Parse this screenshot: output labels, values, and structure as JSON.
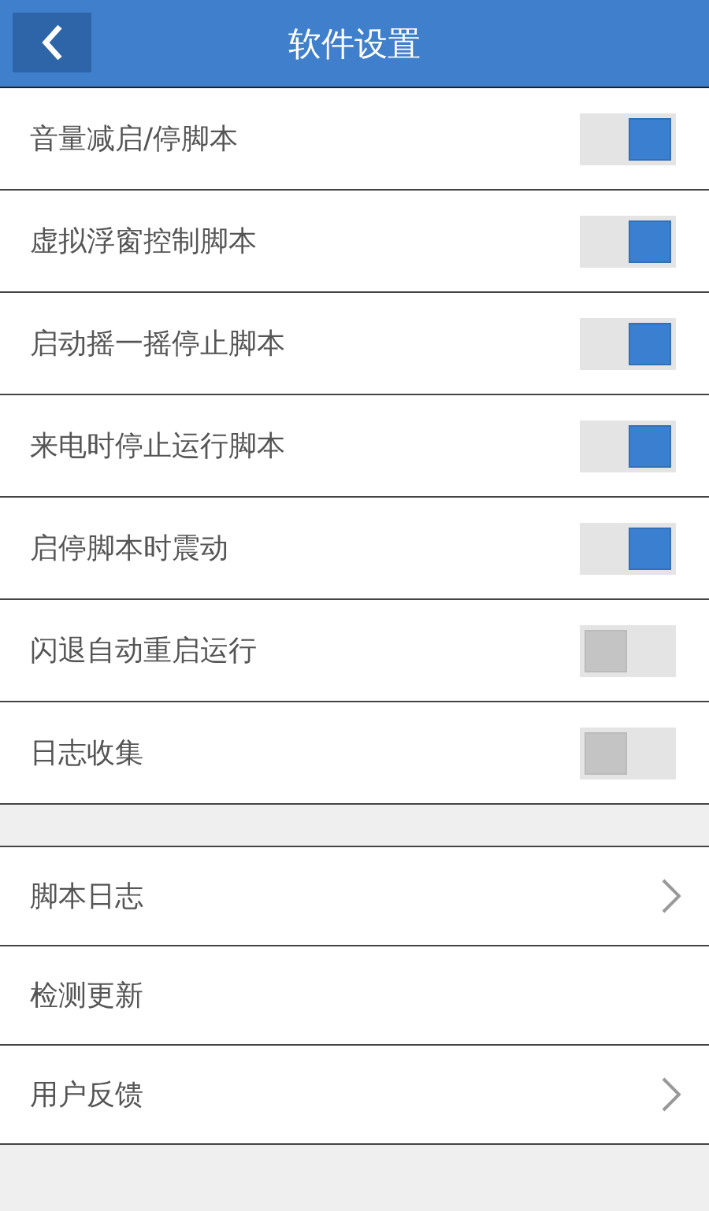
{
  "header": {
    "title": "软件设置"
  },
  "toggles": [
    {
      "label": "音量减启/停脚本",
      "on": true
    },
    {
      "label": "虚拟浮窗控制脚本",
      "on": true
    },
    {
      "label": "启动摇一摇停止脚本",
      "on": true
    },
    {
      "label": "来电时停止运行脚本",
      "on": true
    },
    {
      "label": "启停脚本时震动",
      "on": true
    },
    {
      "label": "闪退自动重启运行",
      "on": false
    },
    {
      "label": "日志收集",
      "on": false
    }
  ],
  "links": [
    {
      "label": "脚本日志",
      "chevron": true
    },
    {
      "label": "检测更新",
      "chevron": false
    },
    {
      "label": "用户反馈",
      "chevron": true
    }
  ]
}
